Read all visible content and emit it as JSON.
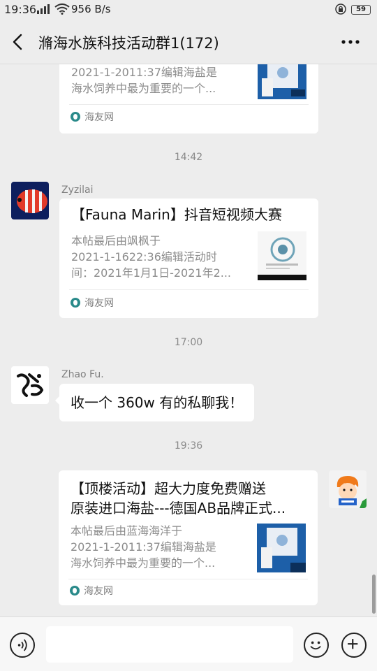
{
  "status_bar": {
    "time": "19:36",
    "network_speed": "956 B/s",
    "battery": "59"
  },
  "header": {
    "title": "滫海水族科技活动群1(172)",
    "back_icon": "chevron-left-icon",
    "more_icon": "more-icon"
  },
  "messages": [
    {
      "type": "link-card",
      "desc_lines": [
        "2021-1-2011:37编辑海盐是",
        "海水饲养中最为重要的一个..."
      ],
      "source": "海友网"
    },
    {
      "type": "time",
      "text": "14:42"
    },
    {
      "type": "link-card",
      "sender": "Zyzilai",
      "title_lines": [
        "【Fauna Marin】抖音短视频大赛"
      ],
      "desc_lines": [
        "本帖最后由飒枫于",
        "2021-1-1622:36编辑活动时",
        "间：2021年1月1日-2021年2..."
      ],
      "source": "海友网"
    },
    {
      "type": "time",
      "text": "17:00"
    },
    {
      "type": "text",
      "sender": "Zhao Fu.",
      "text": "收一个 360w 有的私聊我！"
    },
    {
      "type": "time",
      "text": "19:36"
    },
    {
      "type": "link-card",
      "title_lines": [
        "【顶楼活动】超大力度免费赠送",
        "原装进口海盐---德国AB品牌正式..."
      ],
      "desc_lines": [
        "本帖最后由蓝海海洋于",
        "2021-1-2011:37编辑海盐是",
        "海水饲养中最为重要的一个..."
      ],
      "source": "海友网"
    }
  ],
  "input_bar": {
    "voice_icon": "voice-icon",
    "emoji_icon": "emoji-icon",
    "plus_icon": "plus-icon"
  },
  "colors": {
    "background": "#ededed",
    "bubble": "#ffffff",
    "source_icon": "#2a8a8a"
  }
}
